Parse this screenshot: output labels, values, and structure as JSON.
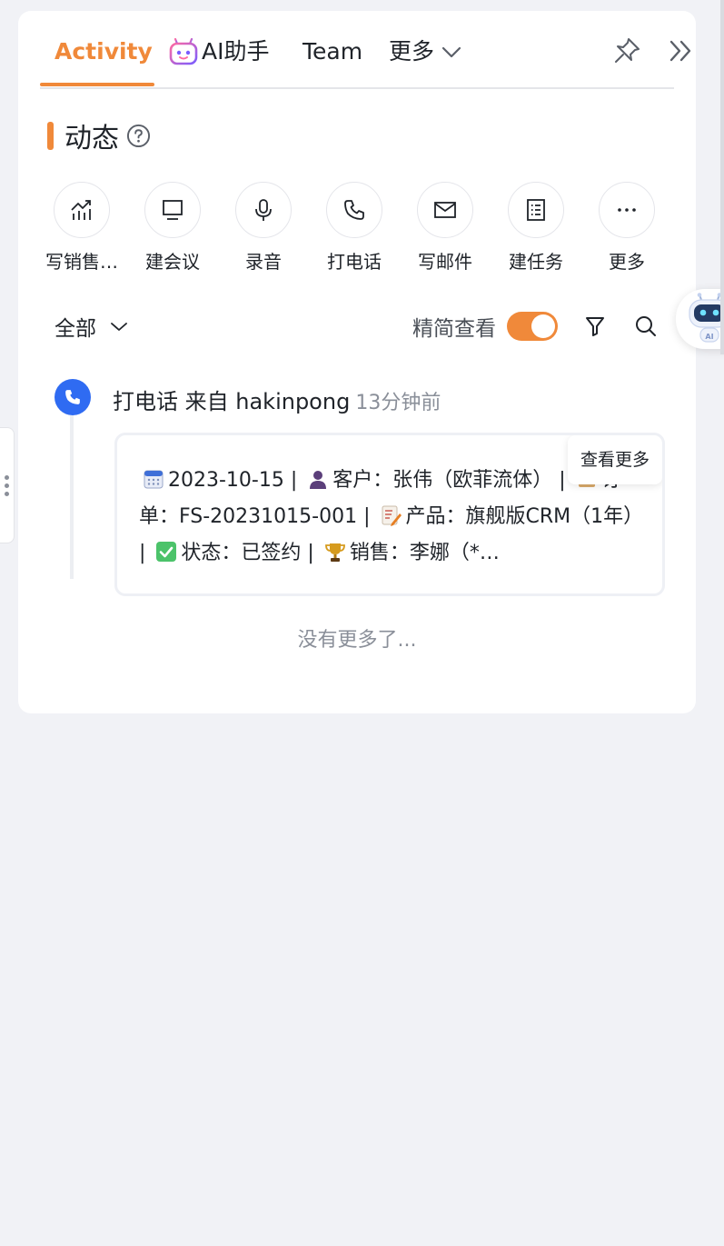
{
  "tabs": {
    "activity": "Activity",
    "ai": "AI助手",
    "team": "Team",
    "more": "更多"
  },
  "section": {
    "title": "动态"
  },
  "actions": [
    {
      "label": "写销售…",
      "icon": "sales-record-icon"
    },
    {
      "label": "建会议",
      "icon": "monitor-icon"
    },
    {
      "label": "录音",
      "icon": "microphone-icon"
    },
    {
      "label": "打电话",
      "icon": "phone-icon"
    },
    {
      "label": "写邮件",
      "icon": "mail-icon"
    },
    {
      "label": "建任务",
      "icon": "task-list-icon"
    },
    {
      "label": "更多",
      "icon": "ellipsis-icon"
    }
  ],
  "filter": {
    "scope": "全部",
    "concise_label": "精简查看",
    "concise_on": true
  },
  "timeline": {
    "event_title": "打电话 来自 hakinpong",
    "time": "13分钟前",
    "see_more": "查看更多",
    "segments": {
      "date": "2023-10-15",
      "customer": "客户：张伟（欧菲流体）",
      "order": "订单：FS-20231015-001",
      "product": "产品：旗舰版CRM（1年）",
      "status": "状态：已签约",
      "sales": "销售：李娜（*…"
    }
  },
  "footer": {
    "no_more": "没有更多了..."
  },
  "colors": {
    "accent": "#f0893a",
    "phone_dot": "#2f6bf2",
    "muted": "#8a8f99",
    "page_bg": "#f1f2f6"
  }
}
